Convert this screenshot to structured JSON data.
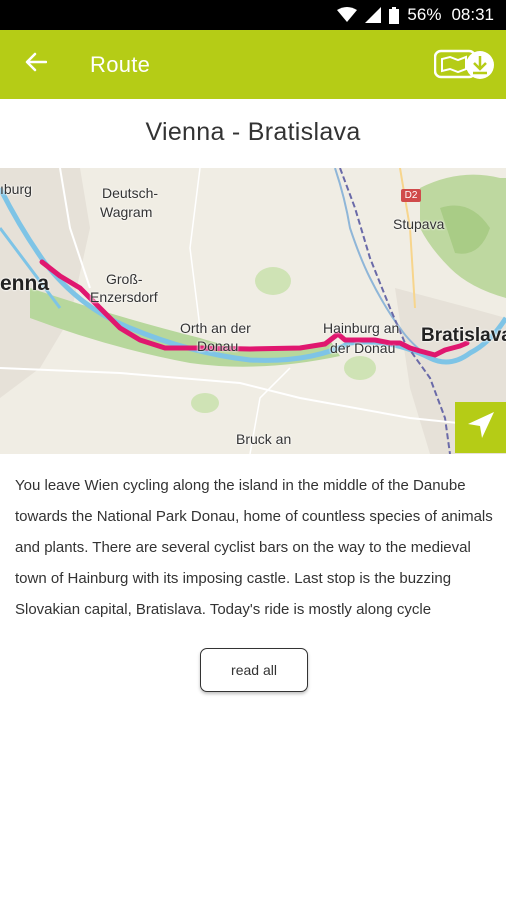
{
  "status_bar": {
    "battery": "56%",
    "time": "08:31",
    "icons": [
      "wifi-icon",
      "signal-icon",
      "battery-icon"
    ]
  },
  "app_bar": {
    "title": "Route",
    "back_icon": "arrow-left-icon",
    "action_icon": "offline-map-download-icon",
    "color": "#b5cc16"
  },
  "route": {
    "title": "Vienna - Bratislava",
    "route_color": "#e0176f",
    "description": "You leave Wien cycling along the island in the middle of the Danube towards the National Park Donau, home of countless species of animals and plants. There are several cyclist bars on the way to the medieval town of Hainburg with its imposing castle. Last stop is the buzzing Slovakian capital, Bratislava. Today's ride is mostly along cycle",
    "read_all_label": "read all"
  },
  "map": {
    "labels": {
      "burg": "ıburg",
      "deutsch": "Deutsch-",
      "wagram": "Wagram",
      "stupava": "Stupava",
      "vienna": "enna",
      "gross": "Groß-",
      "enzersdorf": "Enzersdorf",
      "orth1": "Orth an der",
      "orth2": "Donau",
      "hainburg1": "Hainburg an",
      "hainburg2": "der Donau",
      "bratislava": "Bratislava",
      "bruck": "Bruck an",
      "road_d2": "D2"
    },
    "locate_icon": "navigation-arrow-icon"
  }
}
